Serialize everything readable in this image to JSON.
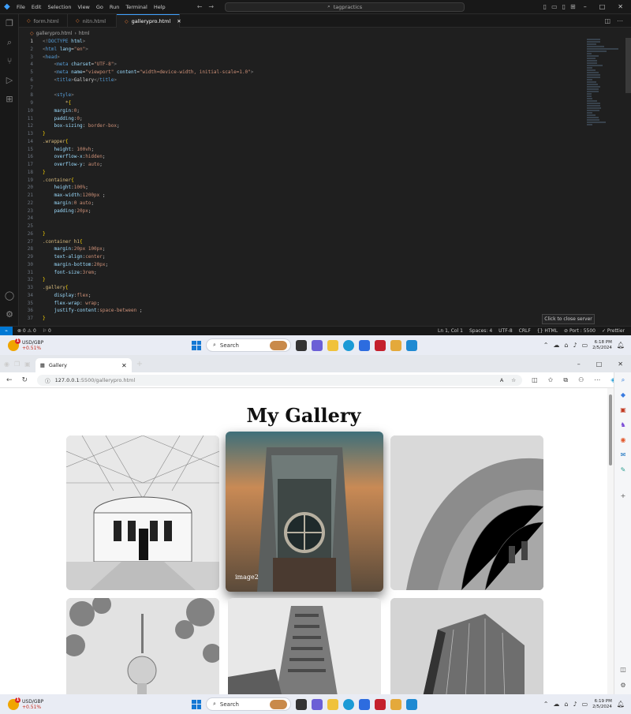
{
  "vscode": {
    "menu": [
      "File",
      "Edit",
      "Selection",
      "View",
      "Go",
      "Run",
      "Terminal",
      "Help"
    ],
    "command_center": "tagpractics",
    "tabs": [
      {
        "label": "form.html",
        "active": false
      },
      {
        "label": "nitn.html",
        "active": false
      },
      {
        "label": "gallerypro.html",
        "active": true
      }
    ],
    "breadcrumb": "gallerypro.html",
    "breadcrumb_tail": "html",
    "code_lines": [
      {
        "n": "1",
        "html": "<span class='g'>&lt;!</span><span class='t'>DOCTYPE</span> <span class='a'>html</span><span class='g'>&gt;</span>"
      },
      {
        "n": "2",
        "html": "<span class='g'>&lt;</span><span class='t'>html</span> <span class='a'>lang</span>=<span class='s'>\"en\"</span><span class='g'>&gt;</span>"
      },
      {
        "n": "3",
        "html": "<span class='g'>&lt;</span><span class='t'>head</span><span class='g'>&gt;</span>"
      },
      {
        "n": "4",
        "html": "    <span class='g'>&lt;</span><span class='t'>meta</span> <span class='a'>charset</span>=<span class='s'>\"UTF-8\"</span><span class='g'>&gt;</span>"
      },
      {
        "n": "5",
        "html": "    <span class='g'>&lt;</span><span class='t'>meta</span> <span class='a'>name</span>=<span class='s'>\"viewport\"</span> <span class='a'>content</span>=<span class='s'>\"width=device-width, initial-scale=1.0\"</span><span class='g'>&gt;</span>"
      },
      {
        "n": "6",
        "html": "    <span class='g'>&lt;</span><span class='t'>title</span><span class='g'>&gt;</span>Gallery<span class='g'>&lt;/</span><span class='t'>title</span><span class='g'>&gt;</span>"
      },
      {
        "n": "7",
        "html": ""
      },
      {
        "n": "8",
        "html": "    <span class='g'>&lt;</span><span class='t'>style</span><span class='g'>&gt;</span>"
      },
      {
        "n": "9",
        "html": "        <span class='sel'>*</span><span class='b'>{</span>"
      },
      {
        "n": "10",
        "html": "    <span class='p'>margin</span>:<span class='v'>0</span>;"
      },
      {
        "n": "11",
        "html": "    <span class='p'>padding</span>:<span class='v'>0</span>;"
      },
      {
        "n": "12",
        "html": "    <span class='p'>box-sizing</span>: <span class='v'>border-box</span>;"
      },
      {
        "n": "13",
        "html": "<span class='b'>}</span>"
      },
      {
        "n": "14",
        "html": "<span class='sel'>.wrapper</span><span class='b'>{</span>"
      },
      {
        "n": "15",
        "html": "    <span class='p'>height</span>: <span class='v'>100vh</span>;"
      },
      {
        "n": "16",
        "html": "    <span class='p'>overflow-x</span>:<span class='v'>hidden</span>;"
      },
      {
        "n": "17",
        "html": "    <span class='p'>overflow-y</span>: <span class='v'>auto</span>;"
      },
      {
        "n": "18",
        "html": "<span class='b'>}</span>"
      },
      {
        "n": "19",
        "html": "<span class='sel'>.container</span><span class='b'>{</span>"
      },
      {
        "n": "20",
        "html": "    <span class='p'>height</span>:<span class='v'>100%</span>;"
      },
      {
        "n": "21",
        "html": "    <span class='p'>max-width</span>:<span class='v'>1200px</span> ;"
      },
      {
        "n": "22",
        "html": "    <span class='p'>margin</span>:<span class='v'>0 auto</span>;"
      },
      {
        "n": "23",
        "html": "    <span class='p'>padding</span>:<span class='v'>20px</span>;"
      },
      {
        "n": "24",
        "html": ""
      },
      {
        "n": "25",
        "html": ""
      },
      {
        "n": "26",
        "html": "<span class='b'>}</span>"
      },
      {
        "n": "27",
        "html": "<span class='sel'>.container h1</span><span class='b'>{</span>"
      },
      {
        "n": "28",
        "html": "    <span class='p'>margin</span>:<span class='v'>20px 100px</span>;"
      },
      {
        "n": "29",
        "html": "    <span class='p'>text-align</span>:<span class='v'>center</span>;"
      },
      {
        "n": "30",
        "html": "    <span class='p'>margin-bottom</span>:<span class='v'>20px</span>;"
      },
      {
        "n": "31",
        "html": "    <span class='p'>font-size</span>:<span class='v'>3rem</span>;"
      },
      {
        "n": "32",
        "html": "<span class='b'>}</span>"
      },
      {
        "n": "33",
        "html": "<span class='sel'>.gallery</span><span class='b'>{</span>"
      },
      {
        "n": "34",
        "html": "    <span class='p'>display</span>:<span class='v'>flex</span>;"
      },
      {
        "n": "35",
        "html": "    <span class='p'>flex-wrap</span>: <span class='v'>wrap</span>;"
      },
      {
        "n": "36",
        "html": "    <span class='p'>justify-content</span>:<span class='v'>space-between</span> ;"
      },
      {
        "n": "37",
        "html": "<span class='b'>}</span>"
      }
    ],
    "tooltip": "Click to close server",
    "status_left": [
      "⊗ 0 ⚠ 0",
      "⚐ 0"
    ],
    "status_right": [
      "Ln 1, Col 1",
      "Spaces: 4",
      "UTF-8",
      "CRLF",
      "{} HTML",
      "⊘ Port : 5500",
      "✓ Prettier"
    ]
  },
  "taskbar_top": {
    "ticker": "USD/GBP",
    "change": "+0.51%",
    "search": "Search",
    "time": "6:18 PM",
    "date": "2/5/2024"
  },
  "taskbar_bottom": {
    "ticker": "USD/GBP",
    "change": "+0.51%",
    "search": "Search",
    "time": "6:19 PM",
    "date": "2/5/2024"
  },
  "browser": {
    "tab_title": "Gallery",
    "url_host": "127.0.0.1",
    "url_path": ":5500/gallerypro.html",
    "page_title": "My Gallery",
    "hover_caption": "image2"
  },
  "colors": {
    "vscode_accent": "#0078d4",
    "browser_bg": "#ffffff"
  }
}
